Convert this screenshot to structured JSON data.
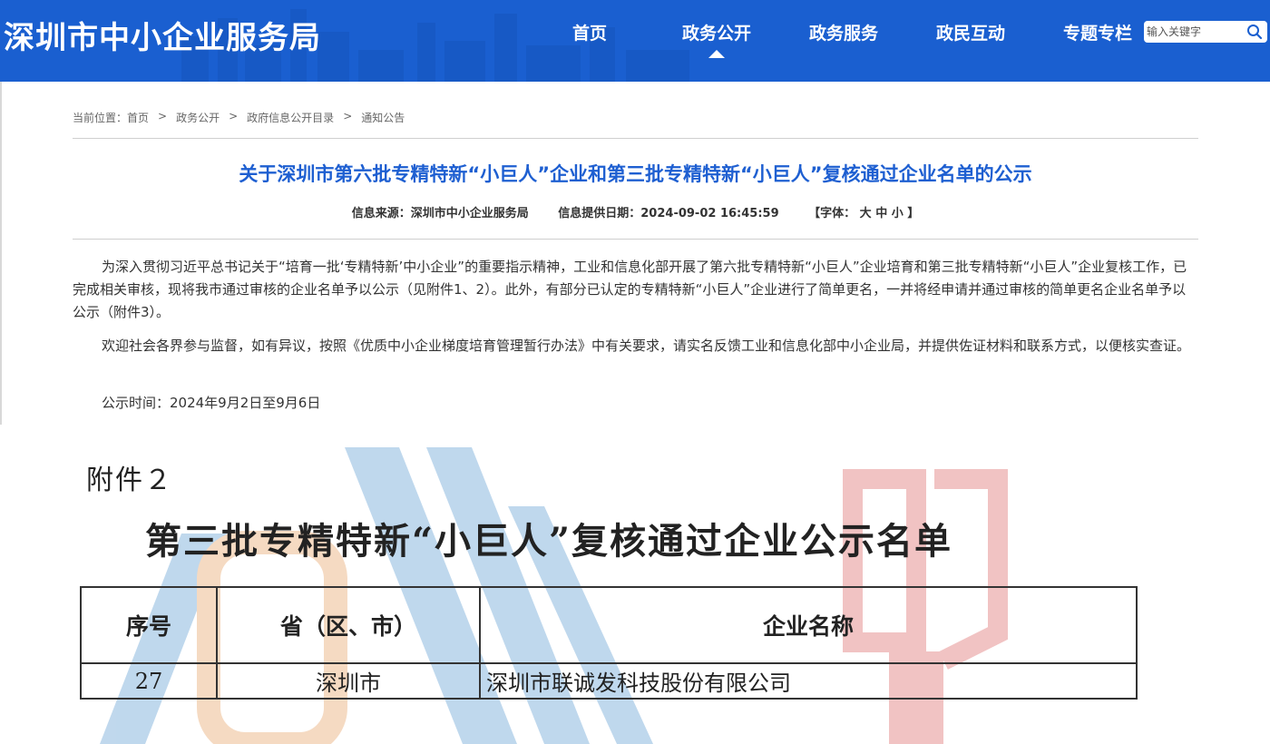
{
  "header": {
    "site_title": "深圳市中小企业服务局",
    "nav": [
      "首页",
      "政务公开",
      "政务服务",
      "政民互动",
      "专题专栏"
    ],
    "active_nav_index": 1,
    "search_placeholder": "输入关键字"
  },
  "breadcrumb": {
    "prefix": "当前位置：",
    "items": [
      "首页",
      "政务公开",
      "政府信息公开目录",
      "通知公告"
    ],
    "separator": ">"
  },
  "article": {
    "title": "关于深圳市第六批专精特新“小巨人”企业和第三批专精特新“小巨人”复核通过企业名单的公示",
    "source": "信息来源：深圳市中小企业服务局",
    "date": "信息提供日期：2024-09-02 16:45:59",
    "font_size_control": "【字体： 大  中  小 】",
    "paragraphs": [
      "为深入贯彻习近平总书记关于“培育一批‘专精特新’中小企业”的重要指示精神，工业和信息化部开展了第六批专精特新“小巨人”企业培育和第三批专精特新“小巨人”企业复核工作，已完成相关审核，现将我市通过审核的企业名单予以公示（见附件1、2）。此外，有部分已认定的专精特新“小巨人”企业进行了简单更名，一并将经申请并通过审核的简单更名企业名单予以公示（附件3）。",
      "欢迎社会各界参与监督，如有异议，按照《优质中小企业梯度培育管理暂行办法》中有关要求，请实名反馈工业和信息化部中小企业局，并提供佐证材料和联系方式，以便核实查证。",
      "公示时间：2024年9月2日至9月6日"
    ]
  },
  "attachment": {
    "label": "附件２",
    "title": "第三批专精特新“小巨人”复核通过企业公示名单",
    "columns": [
      "序号",
      "省（区、市）",
      "企业名称"
    ],
    "rows": [
      [
        "27",
        "深圳市",
        "深圳市联诚发科技股份有限公司"
      ]
    ]
  },
  "colors": {
    "header_bg": "#1a5fd0",
    "title_blue": "#1e5fd1",
    "watermark_blue": "#2f7fc4",
    "watermark_orange": "#e0883a",
    "watermark_red": "#d23b3b"
  }
}
